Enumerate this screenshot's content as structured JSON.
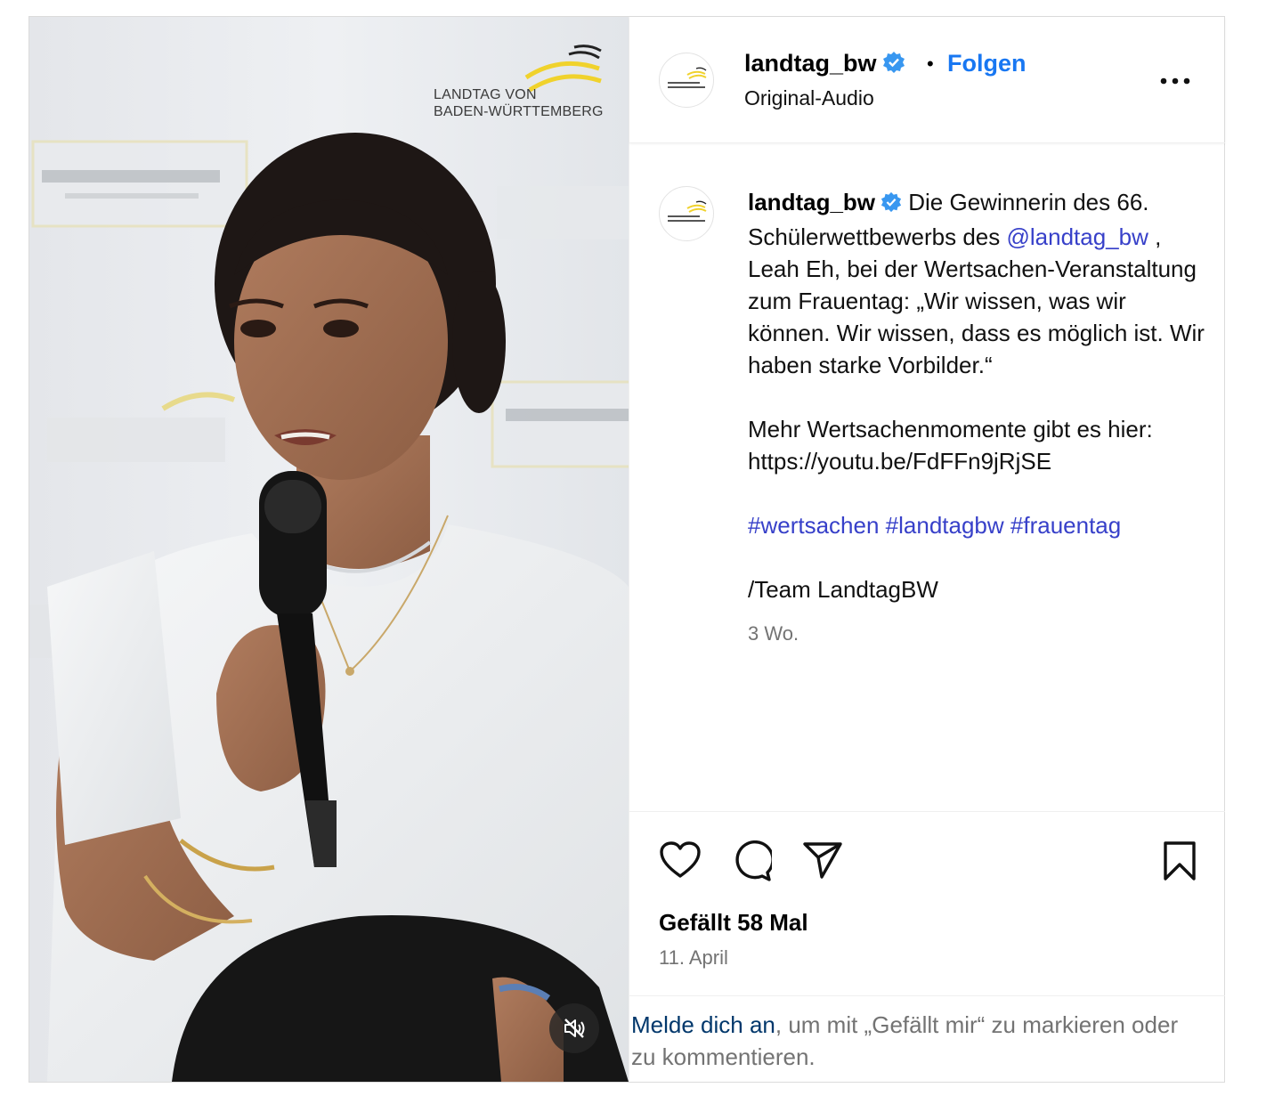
{
  "media": {
    "brand_line1": "LANDTAG VON",
    "brand_line2": "BADEN-WÜRTTEMBERG",
    "mute_icon": "speaker-muted-icon"
  },
  "header": {
    "username": "landtag_bw",
    "separator": "•",
    "follow_label": "Folgen",
    "audio_label": "Original-Audio"
  },
  "caption": {
    "username": "landtag_bw",
    "text_part1": "Die Gewinnerin des 66. Schülerwettbewerbs des ",
    "mention": "@landtag_bw",
    "text_part2": ", Leah Eh, bei der Wertsachen-Veranstaltung zum Frauentag: „Wir wissen, was wir können. Wir wissen, dass es möglich ist. Wir haben starke Vorbilder.“",
    "paragraph2": "Mehr Wertsachenmomente gibt es hier: https://youtu.be/FdFFn9jRjSE",
    "hashtags": [
      "#wertsachen",
      "#landtagbw",
      "#frauentag"
    ],
    "signoff": "/Team LandtagBW",
    "time": "3 Wo."
  },
  "actions": {
    "likes": "Gefällt 58 Mal",
    "date": "11. April"
  },
  "login_prompt": {
    "signin_link": "Melde dich an",
    "rest": ", um mit „Gefällt mir“ zu markieren oder zu kommentieren."
  },
  "colors": {
    "accent": "#1877f2",
    "verified": "#3897f0",
    "link": "#3740c9",
    "brand_yellow": "#f0d22c"
  }
}
